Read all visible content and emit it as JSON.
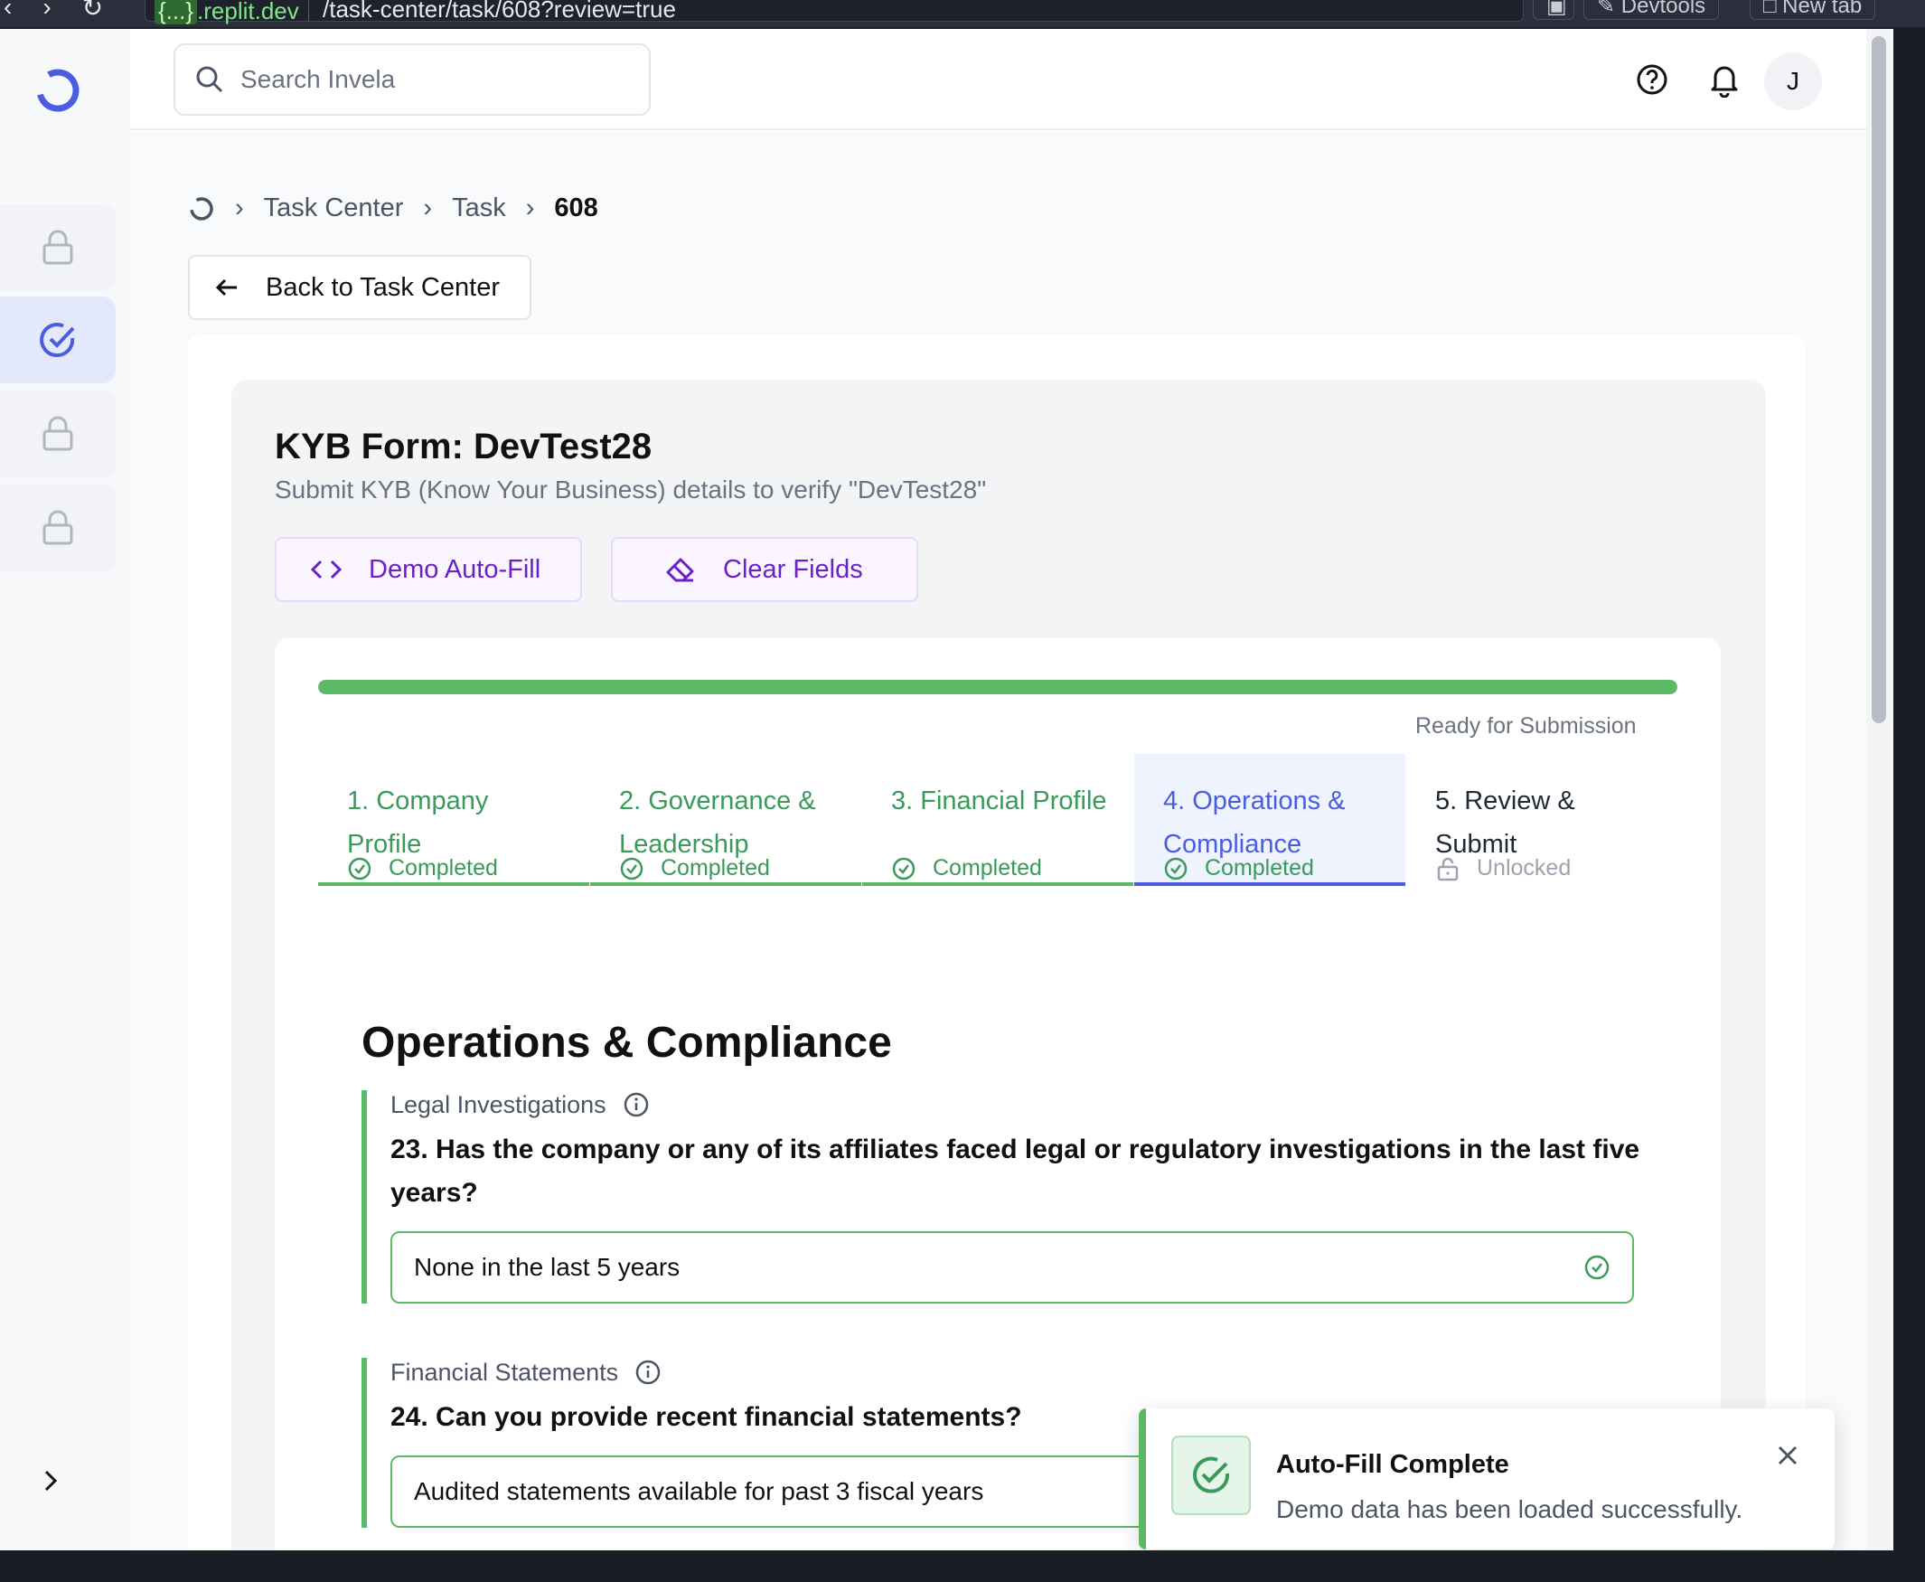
{
  "browser": {
    "host_prefix": "{...}",
    "host": ".replit.dev",
    "path": "/task-center/task/608?review=true",
    "devtools_label": "Devtools",
    "new_tab_label": "New tab"
  },
  "topbar": {
    "search_placeholder": "Search Invela",
    "avatar_initial": "J"
  },
  "breadcrumb": {
    "items": [
      "Task Center",
      "Task"
    ],
    "current": "608"
  },
  "back_button": "Back to Task Center",
  "form": {
    "title": "KYB Form: DevTest28",
    "subtitle": "Submit KYB (Know Your Business) details to verify \"DevTest28\"",
    "demo_autofill_label": "Demo Auto-Fill",
    "clear_fields_label": "Clear Fields",
    "progress_percent": 100,
    "progress_label": "Ready for Submission",
    "accent_green": "#5cba67",
    "accent_blue": "#4a5de0",
    "accent_purple": "#6b21c8"
  },
  "tabs": [
    {
      "label": "1. Company Profile",
      "status": "Completed",
      "state": "done"
    },
    {
      "label": "2. Governance & Leadership",
      "status": "Completed",
      "state": "done"
    },
    {
      "label": "3. Financial Profile",
      "status": "Completed",
      "state": "done"
    },
    {
      "label": "4. Operations & Compliance",
      "status": "Completed",
      "state": "active"
    },
    {
      "label": "5. Review & Submit",
      "status": "Unlocked",
      "state": "open"
    }
  ],
  "section": {
    "title": "Operations & Compliance",
    "questions": [
      {
        "category": "Legal Investigations",
        "text": "23. Has the company or any of its affiliates faced legal or regulatory investigations in the last five years?",
        "answer": "None in the last 5 years"
      },
      {
        "category": "Financial Statements",
        "text": "24. Can you provide recent financial statements?",
        "answer": "Audited statements available for past 3 fiscal years"
      }
    ]
  },
  "toast": {
    "title": "Auto-Fill Complete",
    "message": "Demo data has been loaded successfully."
  }
}
